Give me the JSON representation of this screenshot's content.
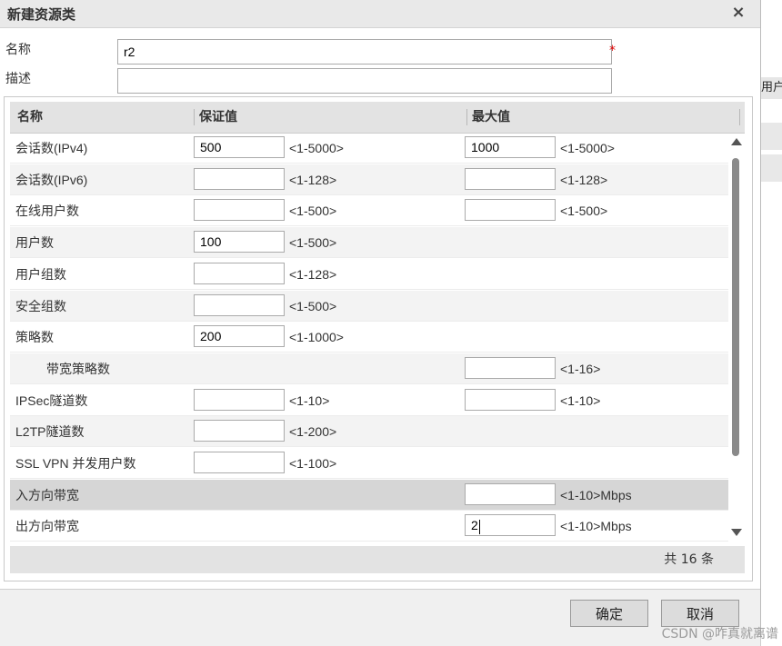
{
  "dialog": {
    "title": "新建资源类",
    "close_glyph": "×"
  },
  "form": {
    "name_label": "名称",
    "name_value": "r2",
    "required_mark": "*",
    "desc_label": "描述",
    "desc_value": ""
  },
  "grid": {
    "headers": [
      "名称",
      "保证值",
      "最大值"
    ],
    "rows": [
      {
        "name": "会话数(IPv4)",
        "guaranteed": "500",
        "guaranteed_hint": "<1-5000>",
        "max": "1000",
        "max_hint": "<1-5000>"
      },
      {
        "name": "会话数(IPv6)",
        "guaranteed": "",
        "guaranteed_hint": "<1-128>",
        "max": "",
        "max_hint": "<1-128>"
      },
      {
        "name": "在线用户数",
        "guaranteed": "",
        "guaranteed_hint": "<1-500>",
        "max": "",
        "max_hint": "<1-500>"
      },
      {
        "name": "用户数",
        "guaranteed": "100",
        "guaranteed_hint": "<1-500>"
      },
      {
        "name": "用户组数",
        "guaranteed": "",
        "guaranteed_hint": "<1-128>"
      },
      {
        "name": "安全组数",
        "guaranteed": "",
        "guaranteed_hint": "<1-500>"
      },
      {
        "name": "策略数",
        "guaranteed": "200",
        "guaranteed_hint": "<1-1000>"
      },
      {
        "name": "带宽策略数",
        "max": "",
        "max_hint": "<1-16>"
      },
      {
        "name": "IPSec隧道数",
        "guaranteed": "",
        "guaranteed_hint": "<1-10>",
        "max": "",
        "max_hint": "<1-10>"
      },
      {
        "name": "L2TP隧道数",
        "guaranteed": "",
        "guaranteed_hint": "<1-200>"
      },
      {
        "name": "SSL VPN 并发用户数",
        "guaranteed": "",
        "guaranteed_hint": "<1-100>"
      },
      {
        "name": "入方向带宽",
        "max": "",
        "max_hint": "<1-10>Mbps"
      },
      {
        "name": "出方向带宽",
        "max": "2",
        "max_hint": "<1-10>Mbps"
      }
    ],
    "footer_total": "共 16 条"
  },
  "buttons": {
    "ok": "确定",
    "cancel": "取消"
  },
  "background": {
    "tab_fragment": "用户"
  },
  "watermark": "CSDN @咋真就离谱"
}
